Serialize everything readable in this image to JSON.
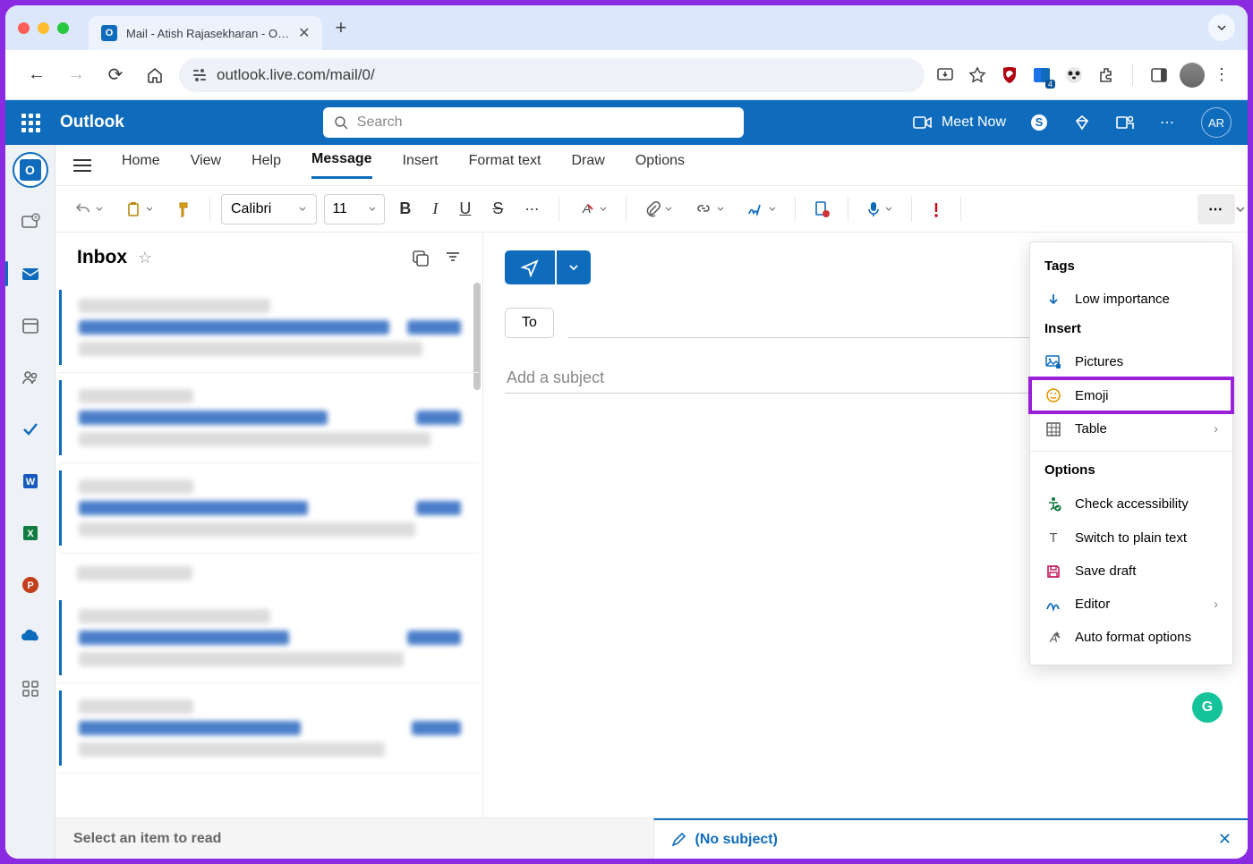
{
  "browser": {
    "tab_title": "Mail - Atish Rajasekharan - O…",
    "url": "outlook.live.com/mail/0/"
  },
  "header": {
    "brand": "Outlook",
    "search_placeholder": "Search",
    "meet_now": "Meet Now",
    "user_initials": "AR"
  },
  "ribbon": {
    "tabs": {
      "home": "Home",
      "view": "View",
      "help": "Help",
      "message": "Message",
      "insert": "Insert",
      "format": "Format text",
      "draw": "Draw",
      "options": "Options"
    },
    "font_name": "Calibri",
    "font_size": "11"
  },
  "inbox": {
    "title": "Inbox"
  },
  "compose": {
    "to_label": "To",
    "subject_placeholder": "Add a subject"
  },
  "status": {
    "select_item": "Select an item to read",
    "no_subject": "(No subject)"
  },
  "dropdown": {
    "tags": "Tags",
    "low_importance": "Low importance",
    "insert": "Insert",
    "pictures": "Pictures",
    "emoji": "Emoji",
    "table": "Table",
    "options": "Options",
    "check_accessibility": "Check accessibility",
    "switch_plain": "Switch to plain text",
    "save_draft": "Save draft",
    "editor": "Editor",
    "auto_format": "Auto format options"
  }
}
